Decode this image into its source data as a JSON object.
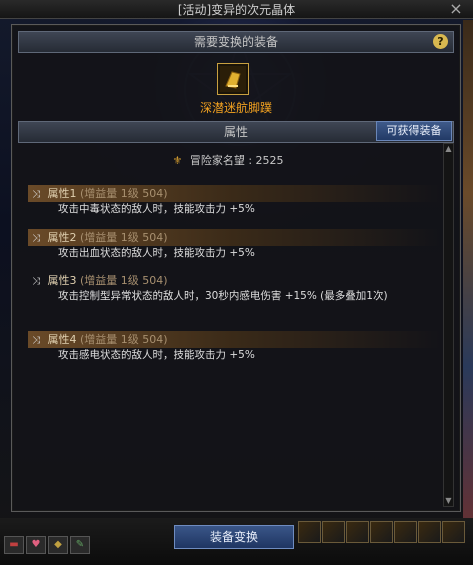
{
  "window": {
    "title": "[活动]变异的次元晶体",
    "close_symbol": "×"
  },
  "header": {
    "section_title": "需要变换的装备",
    "help_symbol": "?"
  },
  "equipment": {
    "name": "深潜迷航脚蹼",
    "color": "#f0a020"
  },
  "attributes": {
    "section_title": "属性",
    "obtain_button": "可获得装备",
    "fame_label": "冒险家名望 : 2525",
    "properties": [
      {
        "title": "属性1",
        "level": "(增益量 1级 504)",
        "desc": "攻击中毒状态的敌人时，技能攻击力 +5%",
        "highlighted": true
      },
      {
        "title": "属性2",
        "level": "(增益量 1级 504)",
        "desc": "攻击出血状态的敌人时，技能攻击力 +5%",
        "highlighted": true
      },
      {
        "title": "属性3",
        "level": "(增益量 1级 504)",
        "desc": "攻击控制型异常状态的敌人时，30秒内感电伤害 +15% (最多叠加1次)",
        "highlighted": false
      },
      {
        "title": "属性4",
        "level": "(增益量 1级 504)",
        "desc": "攻击感电状态的敌人时，技能攻击力 +5%",
        "highlighted": true
      }
    ]
  },
  "footer": {
    "exchange_button": "装备变换"
  },
  "icons": [
    "close-icon",
    "help-icon",
    "equipment-icon",
    "fame-icon",
    "shuffle-icon"
  ]
}
